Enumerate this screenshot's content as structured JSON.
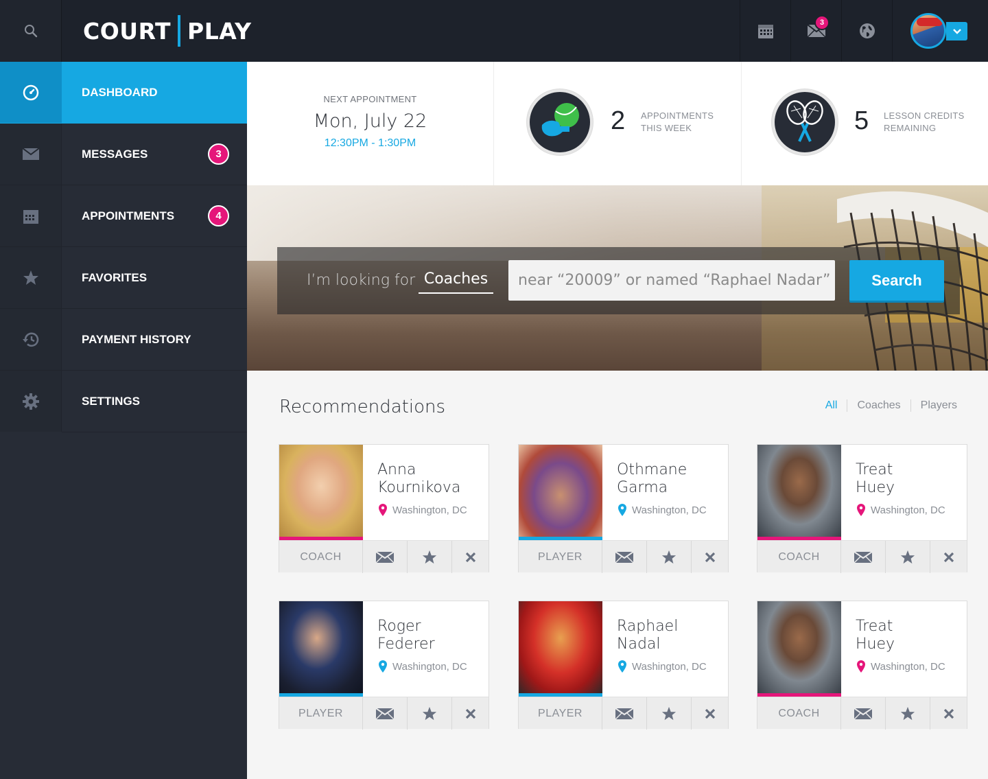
{
  "app": {
    "logo_left": "COURT",
    "logo_right": "PLAY",
    "colors": {
      "accent": "#16a8e2",
      "badge": "#e5167a",
      "dark": "#1d222b",
      "sidebar": "#272c36"
    }
  },
  "topbar": {
    "icons": [
      "search-icon",
      "calendar-icon",
      "mail-icon",
      "globe-icon",
      "chevron-down-icon"
    ],
    "mail_badge": "3"
  },
  "sidebar": {
    "items": [
      {
        "label": "DASHBOARD",
        "icon": "dashboard-icon",
        "active": true,
        "badge": ""
      },
      {
        "label": "MESSAGES",
        "icon": "mail-icon",
        "active": false,
        "badge": "3"
      },
      {
        "label": "APPOINTMENTS",
        "icon": "calendar-icon",
        "active": false,
        "badge": "4"
      },
      {
        "label": "FAVORITES",
        "icon": "star-icon",
        "active": false,
        "badge": ""
      },
      {
        "label": "PAYMENT HISTORY",
        "icon": "history-icon",
        "active": false,
        "badge": ""
      },
      {
        "label": "SETTINGS",
        "icon": "gear-icon",
        "active": false,
        "badge": ""
      }
    ]
  },
  "stats": {
    "next_label": "NEXT APPOINTMENT",
    "next_date": "Mon, July 22",
    "next_time": "12:30PM - 1:30PM",
    "appts_count": "2",
    "appts_caption_1": "APPOINTMENTS",
    "appts_caption_2": "THIS WEEK",
    "credits_count": "5",
    "credits_caption_1": "LESSON CREDITS",
    "credits_caption_2": "REMAINING"
  },
  "search": {
    "lead": "I’m looking for",
    "selected": "Coaches",
    "placeholder": "near “20009” or named “Raphael Nadar”",
    "button": "Search"
  },
  "recommendations": {
    "title": "Recommendations",
    "filters": [
      "All",
      "Coaches",
      "Players"
    ],
    "active_filter": "All",
    "cards": [
      {
        "first": "Anna",
        "last": "Kournikova",
        "location": "Washington, DC",
        "role": "COACH"
      },
      {
        "first": "Othmane",
        "last": "Garma",
        "location": "Washington, DC",
        "role": "PLAYER"
      },
      {
        "first": "Treat",
        "last": "Huey",
        "location": "Washington, DC",
        "role": "COACH"
      },
      {
        "first": "Roger",
        "last": "Federer",
        "location": "Washington, DC",
        "role": "PLAYER"
      },
      {
        "first": "Raphael",
        "last": "Nadal",
        "location": "Washington, DC",
        "role": "PLAYER"
      },
      {
        "first": "Treat",
        "last": "Huey",
        "location": "Washington, DC",
        "role": "COACH"
      }
    ]
  }
}
